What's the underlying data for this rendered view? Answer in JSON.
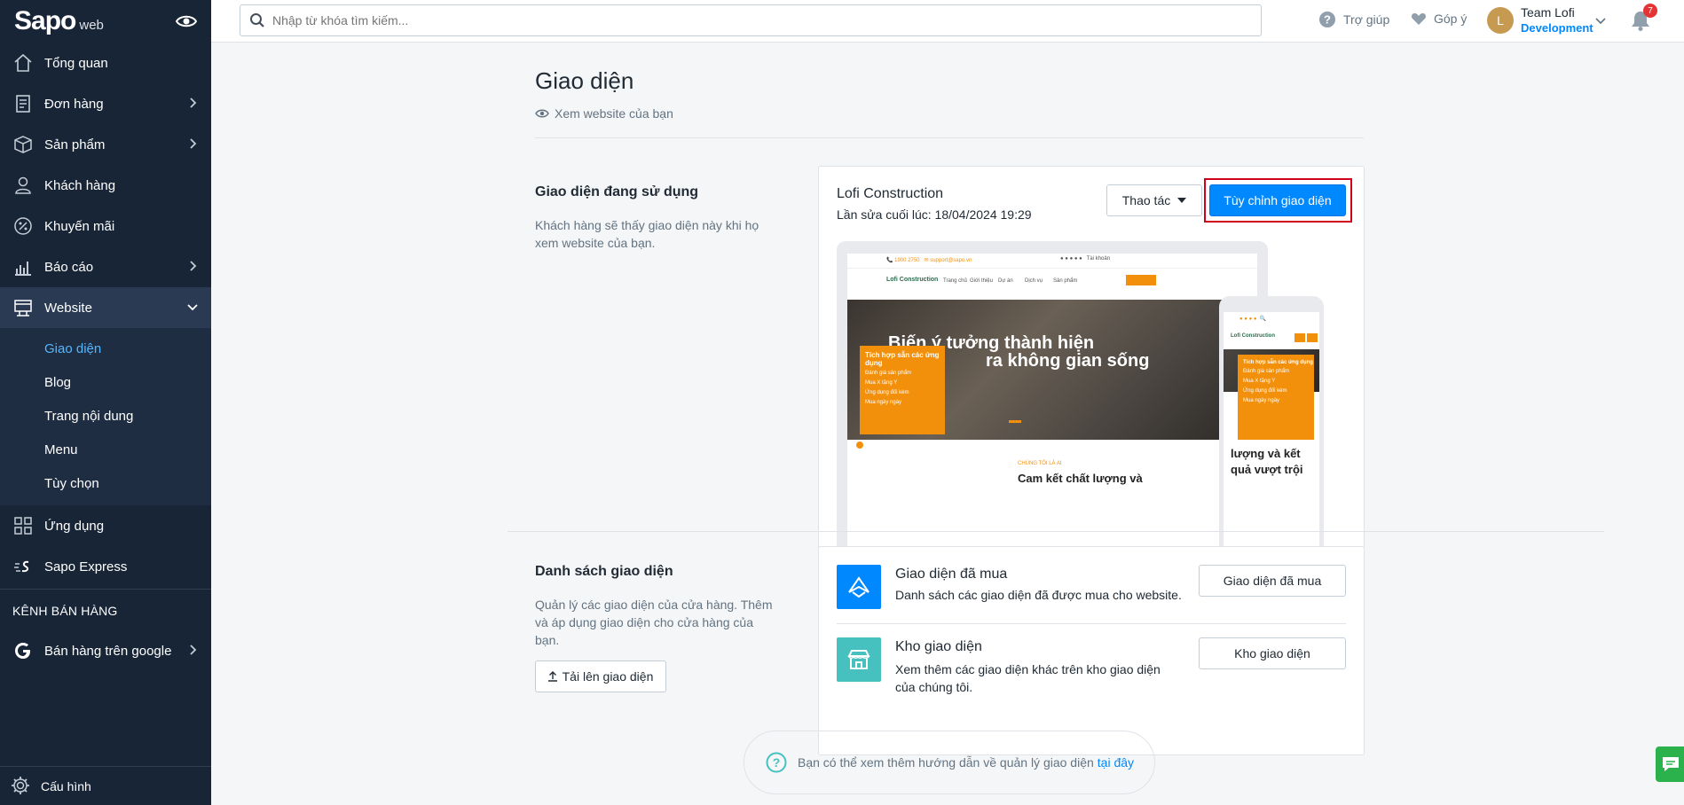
{
  "sidebar": {
    "logo": "Sapo",
    "logo_suffix": "web",
    "items": [
      {
        "label": "Tổng quan",
        "icon": "home-icon"
      },
      {
        "label": "Đơn hàng",
        "icon": "orders-icon"
      },
      {
        "label": "Sản phẩm",
        "icon": "box-icon"
      },
      {
        "label": "Khách hàng",
        "icon": "user-icon"
      },
      {
        "label": "Khuyến mãi",
        "icon": "percent-icon"
      },
      {
        "label": "Báo cáo",
        "icon": "chart-icon"
      },
      {
        "label": "Website",
        "icon": "website-icon"
      }
    ],
    "website_sub": [
      "Giao diện",
      "Blog",
      "Trang nội dung",
      "Menu",
      "Tùy chọn"
    ],
    "apps": "Ứng dụng",
    "sapo_express": "Sapo Express",
    "channels_label": "KÊNH BÁN HÀNG",
    "google": "Bán hàng trên google",
    "settings": "Cấu hình"
  },
  "topbar": {
    "search_placeholder": "Nhập từ khóa tìm kiếm...",
    "help": "Trợ giúp",
    "feedback": "Góp ý",
    "avatar_letter": "L",
    "account_name": "Team Lofi",
    "account_role": "Development",
    "notifications": "7"
  },
  "page": {
    "title": "Giao diện",
    "view_site": "Xem website của bạn"
  },
  "current_theme": {
    "section_title": "Giao diện đang sử dụng",
    "section_desc": "Khách hàng sẽ thấy giao diện này khi họ xem website của bạn.",
    "name": "Lofi Construction",
    "last_edited": "Lần sửa cuối lúc: 18/04/2024 19:29",
    "actions_label": "Thao tác",
    "customize_label": "Tùy chỉnh giao diện"
  },
  "preview": {
    "hero_line1": "Biến ý tưởng thành hiện",
    "hero_line2": "ra không gian sống",
    "popup_title": "Tích hợp sẵn các ứng dụng",
    "popup_items": [
      "Đánh giá sản phẩm",
      "Mua X tặng Y",
      "Ứng dụng đối kèm",
      "Mua ngày ngày"
    ],
    "nav": [
      "Trang chủ",
      "Giới thiệu",
      "Dự án",
      "Dịch vụ",
      "Sản phẩm"
    ],
    "brand": "Lofi Construction",
    "caption": "CHÚNG TÔI LÀ AI",
    "caption_title": "Cam kết chất lượng và",
    "mobile_title1": "lượng và kết",
    "mobile_title2": "quả vượt trội"
  },
  "theme_list": {
    "section_title": "Danh sách giao diện",
    "section_desc": "Quản lý các giao diện của cửa hàng. Thêm và áp dụng giao diện cho cửa hàng của bạn.",
    "upload_label": "Tải lên giao diện",
    "items": [
      {
        "title": "Giao diện đã mua",
        "desc": "Danh sách các giao diện đã được mua cho website.",
        "button": "Giao diện đã mua",
        "color": "#0088ff"
      },
      {
        "title": "Kho giao diện",
        "desc": "Xem thêm các giao diện khác trên kho giao diện của chúng tôi.",
        "button": "Kho giao diện",
        "color": "#47c1bf"
      }
    ]
  },
  "help": {
    "text": "Bạn có thể xem thêm hướng dẫn về quản lý giao diện",
    "link": "tại đây"
  }
}
